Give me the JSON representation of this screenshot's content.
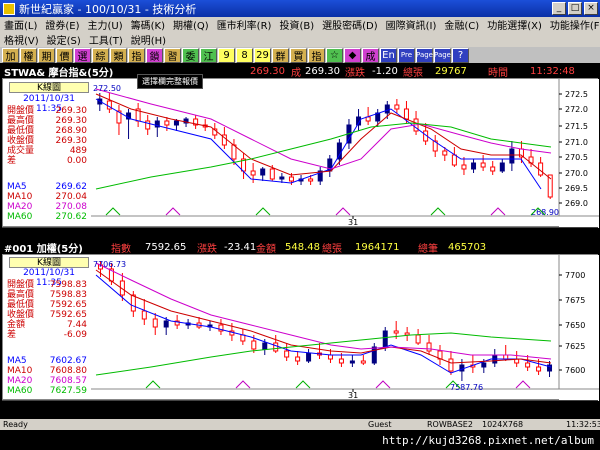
{
  "window": {
    "title": "新世紀贏家 - 100/10/31 - 技術分析"
  },
  "menu": {
    "row1": [
      "畫面(L)",
      "證券(E)",
      "主力(U)",
      "籌碼(K)",
      "期權(Q)",
      "匯市利率(R)",
      "投資(B)",
      "選股密碼(D)",
      "國際資訊(I)",
      "金融(C)",
      "功能選擇(X)",
      "功能操作(F)"
    ],
    "row2": [
      "格視(V)",
      "設定(S)",
      "工具(T)",
      "說明(H)"
    ]
  },
  "toolbar": {
    "buttons": [
      "加",
      "權",
      "期",
      "價",
      "選",
      "綜",
      "類",
      "指",
      "鎖",
      "習",
      "委",
      "江",
      "9",
      "8",
      "29",
      "群",
      "買",
      "指",
      "☆",
      "◆",
      "成",
      "En",
      "Pre",
      "Page",
      "Page",
      "?"
    ]
  },
  "upper": {
    "symbol": "STWA& 摩台指&(5分)",
    "fields": [
      {
        "label": "",
        "value": "269.30"
      },
      {
        "label": "成",
        "value": "269.30"
      },
      {
        "label": "漲跌",
        "value": "-1.20"
      },
      {
        "label": "總張",
        "value": "29767"
      },
      {
        "label": "時間",
        "value": "11:32:48"
      }
    ],
    "hint": "選擇欄完整報價",
    "panel_title": "K線圖",
    "date": "2011/10/31 11:35",
    "stats": [
      {
        "label": "開盤價",
        "value": "269.30"
      },
      {
        "label": "最高價",
        "value": "269.30"
      },
      {
        "label": "最低價",
        "value": "268.90"
      },
      {
        "label": "收盤價",
        "value": "269.30"
      },
      {
        "label": "成交量",
        "value": "489"
      },
      {
        "label": "差",
        "value": "0.00"
      }
    ],
    "mas": [
      {
        "label": "MA5",
        "value": "269.62"
      },
      {
        "label": "MA10",
        "value": "270.04"
      },
      {
        "label": "MA20",
        "value": "270.08"
      },
      {
        "label": "MA60",
        "value": "270.62"
      }
    ],
    "top_price": "272.50",
    "bottom_price": "268.90",
    "axis": [
      "272.5",
      "272.0",
      "271.5",
      "271.0",
      "270.5",
      "270.0",
      "269.5",
      "269.0"
    ],
    "x_label": "31"
  },
  "lower": {
    "symbol": "#001 加權(5分)",
    "fields": [
      {
        "label": "指數",
        "value": "7592.65"
      },
      {
        "label": "漲跌",
        "value": "-23.41"
      },
      {
        "label": "金額",
        "value": "548.48"
      },
      {
        "label": "總張",
        "value": "1964171"
      },
      {
        "label": "總筆",
        "value": "465703"
      }
    ],
    "panel_title": "K線圖",
    "date": "2011/10/31 11:35",
    "stats": [
      {
        "label": "開盤價",
        "value": "7598.83"
      },
      {
        "label": "最高價",
        "value": "7598.83"
      },
      {
        "label": "最低價",
        "value": "7592.65"
      },
      {
        "label": "收盤價",
        "value": "7592.65"
      },
      {
        "label": "金額",
        "value": "7.44"
      },
      {
        "label": "差",
        "value": "-6.09"
      }
    ],
    "mas": [
      {
        "label": "MA5",
        "value": "7602.67"
      },
      {
        "label": "MA10",
        "value": "7608.80"
      },
      {
        "label": "MA20",
        "value": "7608.57"
      },
      {
        "label": "MA60",
        "value": "7627.59"
      }
    ],
    "top_price": "7706.73",
    "bottom_price": "7587.76",
    "axis": [
      "7700",
      "7675",
      "7650",
      "7625",
      "7600"
    ],
    "x_label": "31"
  },
  "status": {
    "ready": "Ready",
    "guest": "Guest",
    "server": "ROWBASE2",
    "res": "1024X768",
    "clock": "11:32:53"
  },
  "watermark": "http://kujd3268.pixnet.net/album",
  "colors": {
    "up": "#ff0000",
    "down": "#000080",
    "ma5": "#0000ff",
    "ma10": "#cc0000",
    "ma20": "#cc00cc",
    "ma60": "#00bb00"
  }
}
